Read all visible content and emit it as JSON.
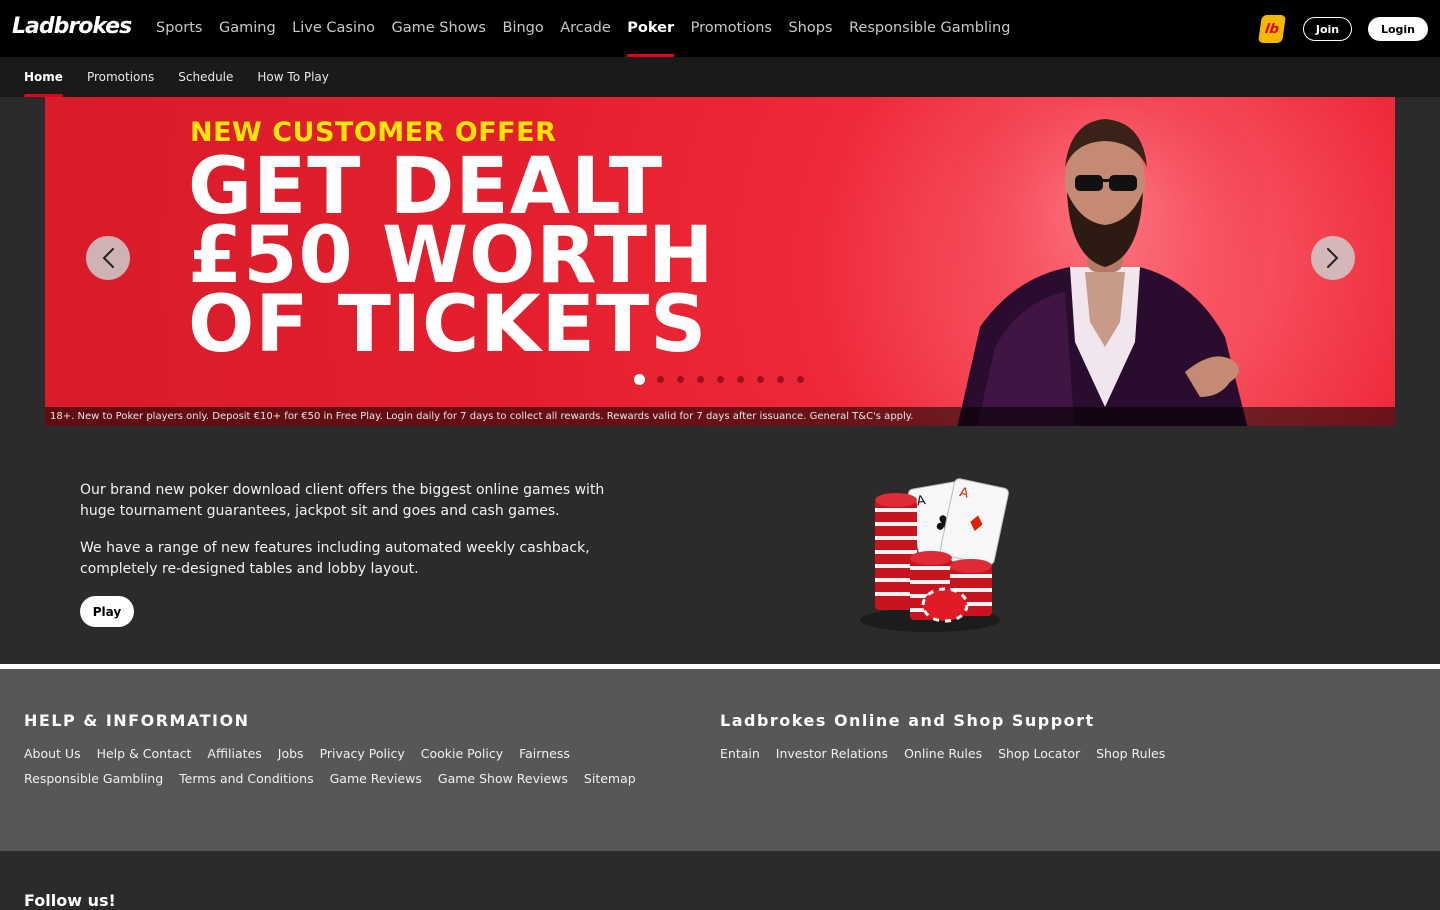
{
  "brand": {
    "logo_text": "Ladbrokes",
    "badge_text": "lb"
  },
  "topnav": {
    "items": [
      {
        "label": "Sports"
      },
      {
        "label": "Gaming"
      },
      {
        "label": "Live Casino"
      },
      {
        "label": "Game Shows"
      },
      {
        "label": "Bingo"
      },
      {
        "label": "Arcade"
      },
      {
        "label": "Poker",
        "active": true
      },
      {
        "label": "Promotions"
      },
      {
        "label": "Shops"
      },
      {
        "label": "Responsible Gambling"
      }
    ],
    "join_label": "Join",
    "login_label": "Login"
  },
  "subnav": {
    "items": [
      {
        "label": "Home",
        "active": true
      },
      {
        "label": "Promotions"
      },
      {
        "label": "Schedule"
      },
      {
        "label": "How To Play"
      }
    ]
  },
  "hero": {
    "eyebrow": "NEW CUSTOMER OFFER",
    "title": "GET DEALT £50 WORTH OF TICKETS",
    "disclaimer": "18+. New to Poker players only. Deposit €10+ for €50 in Free Play. Login daily for 7 days to collect all rewards. Rewards valid for 7 days after issuance. General T&C's apply.",
    "slide_count": 9,
    "active_slide": 1
  },
  "intro": {
    "paragraph_1": "Our brand new poker download client offers the biggest online games with huge tournament guarantees, jackpot sit and goes and cash games.",
    "paragraph_2": "We have a range of new features including automated weekly cashback, completely re-designed tables and lobby layout.",
    "play_label": "Play"
  },
  "footer": {
    "help": {
      "heading": "HELP & INFORMATION",
      "links": [
        "About Us",
        "Help & Contact",
        "Affiliates",
        "Jobs",
        "Privacy Policy",
        "Cookie Policy",
        "Fairness",
        "Responsible Gambling",
        "Terms and Conditions",
        "Game Reviews",
        "Game Show Reviews",
        "Sitemap"
      ]
    },
    "support": {
      "heading": "Ladbrokes Online and Shop Support",
      "links": [
        "Entain",
        "Investor Relations",
        "Online Rules",
        "Shop Locator",
        "Shop Rules"
      ]
    },
    "follow_title": "Follow us!"
  },
  "colors": {
    "brand_red": "#e0001b",
    "offer_yellow": "#ffe600",
    "hero_red": "#e41f2d"
  }
}
